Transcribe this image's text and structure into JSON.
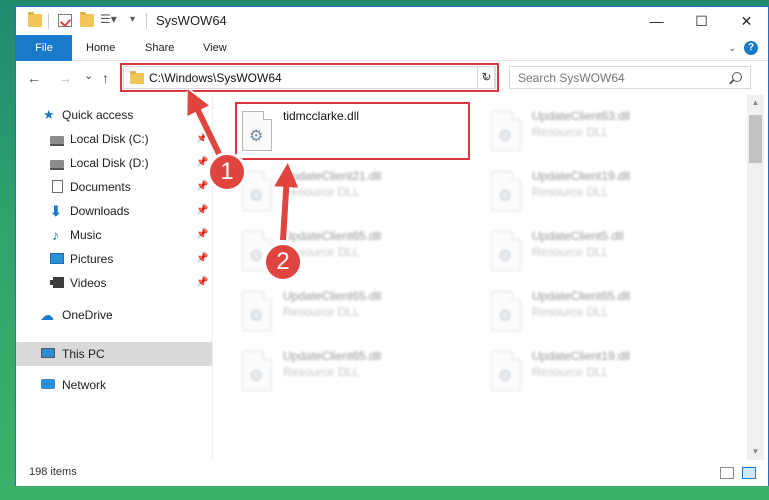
{
  "window": {
    "title": "SysWOW64"
  },
  "window_buttons": {
    "minimize": "—",
    "maximize": "☐",
    "close": "✕"
  },
  "ribbon": {
    "tabs": [
      "File",
      "Home",
      "Share",
      "View"
    ],
    "expand_icon": "chevron-down-icon",
    "help": "?"
  },
  "nav": {
    "back": "←",
    "forward": "→",
    "recent": "⌄",
    "up": "↑",
    "address": "C:\\Windows\\SysWOW64",
    "refresh": "↻",
    "search_placeholder": "Search SysWOW64"
  },
  "sidebar": {
    "items": [
      {
        "label": "Quick access",
        "icon": "star-icon",
        "pinned": false
      },
      {
        "label": "Local Disk (C:)",
        "icon": "disk-icon",
        "pinned": true
      },
      {
        "label": "Local Disk (D:)",
        "icon": "disk-icon",
        "pinned": true
      },
      {
        "label": "Documents",
        "icon": "documents-icon",
        "pinned": true
      },
      {
        "label": "Downloads",
        "icon": "downloads-icon",
        "pinned": true
      },
      {
        "label": "Music",
        "icon": "music-icon",
        "pinned": true
      },
      {
        "label": "Pictures",
        "icon": "pictures-icon",
        "pinned": true
      },
      {
        "label": "Videos",
        "icon": "videos-icon",
        "pinned": true
      },
      {
        "label": "OneDrive",
        "icon": "onedrive-icon",
        "pinned": false
      },
      {
        "label": "This PC",
        "icon": "pc-icon",
        "pinned": false,
        "selected": true
      },
      {
        "label": "Network",
        "icon": "network-icon",
        "pinned": false
      }
    ]
  },
  "files": [
    {
      "name": "tidmcclarke.dll",
      "type": "",
      "highlighted": true
    },
    {
      "name": "UpdateClient63.dll",
      "type": "Resource DLL"
    },
    {
      "name": "UpdateClient21.dll",
      "type": "Resource DLL"
    },
    {
      "name": "UpdateClient19.dll",
      "type": "Resource DLL"
    },
    {
      "name": "UpdateClient65.dll",
      "type": "Resource DLL"
    },
    {
      "name": "UpdateClient5.dll",
      "type": "Resource DLL"
    },
    {
      "name": "UpdateClient65.dll",
      "type": "Resource DLL"
    },
    {
      "name": "UpdateClient65.dll",
      "type": "Resource DLL"
    },
    {
      "name": "UpdateClient65.dll",
      "type": "Resource DLL"
    },
    {
      "name": "UpdateClient19.dll",
      "type": "Resource DLL"
    }
  ],
  "status": {
    "item_count": "198 items"
  },
  "annotations": {
    "step1": "1",
    "step2": "2"
  },
  "colors": {
    "accent": "#1979ca",
    "highlight": "#d9373f",
    "callout": "#e0443e"
  }
}
